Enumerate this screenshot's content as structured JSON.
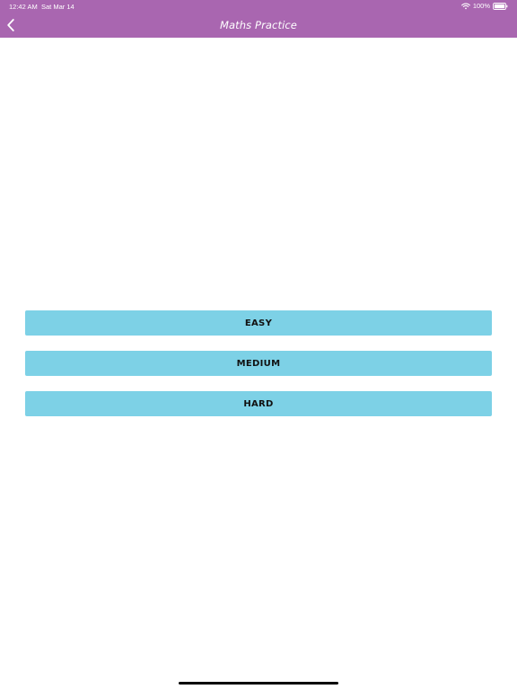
{
  "status_bar": {
    "time": "12:42 AM",
    "date": "Sat Mar 14",
    "battery": "100%",
    "wifi_icon": "wifi-icon",
    "battery_icon": "battery-full-icon"
  },
  "nav": {
    "title": "Maths Practice",
    "back_icon": "chevron-left-icon",
    "bar_color": "#a966b0"
  },
  "levels": [
    {
      "label": "EASY"
    },
    {
      "label": "MEDIUM"
    },
    {
      "label": "HARD"
    }
  ],
  "colors": {
    "button_background": "#7dd1e6",
    "button_text": "#111111",
    "background": "#ffffff"
  }
}
